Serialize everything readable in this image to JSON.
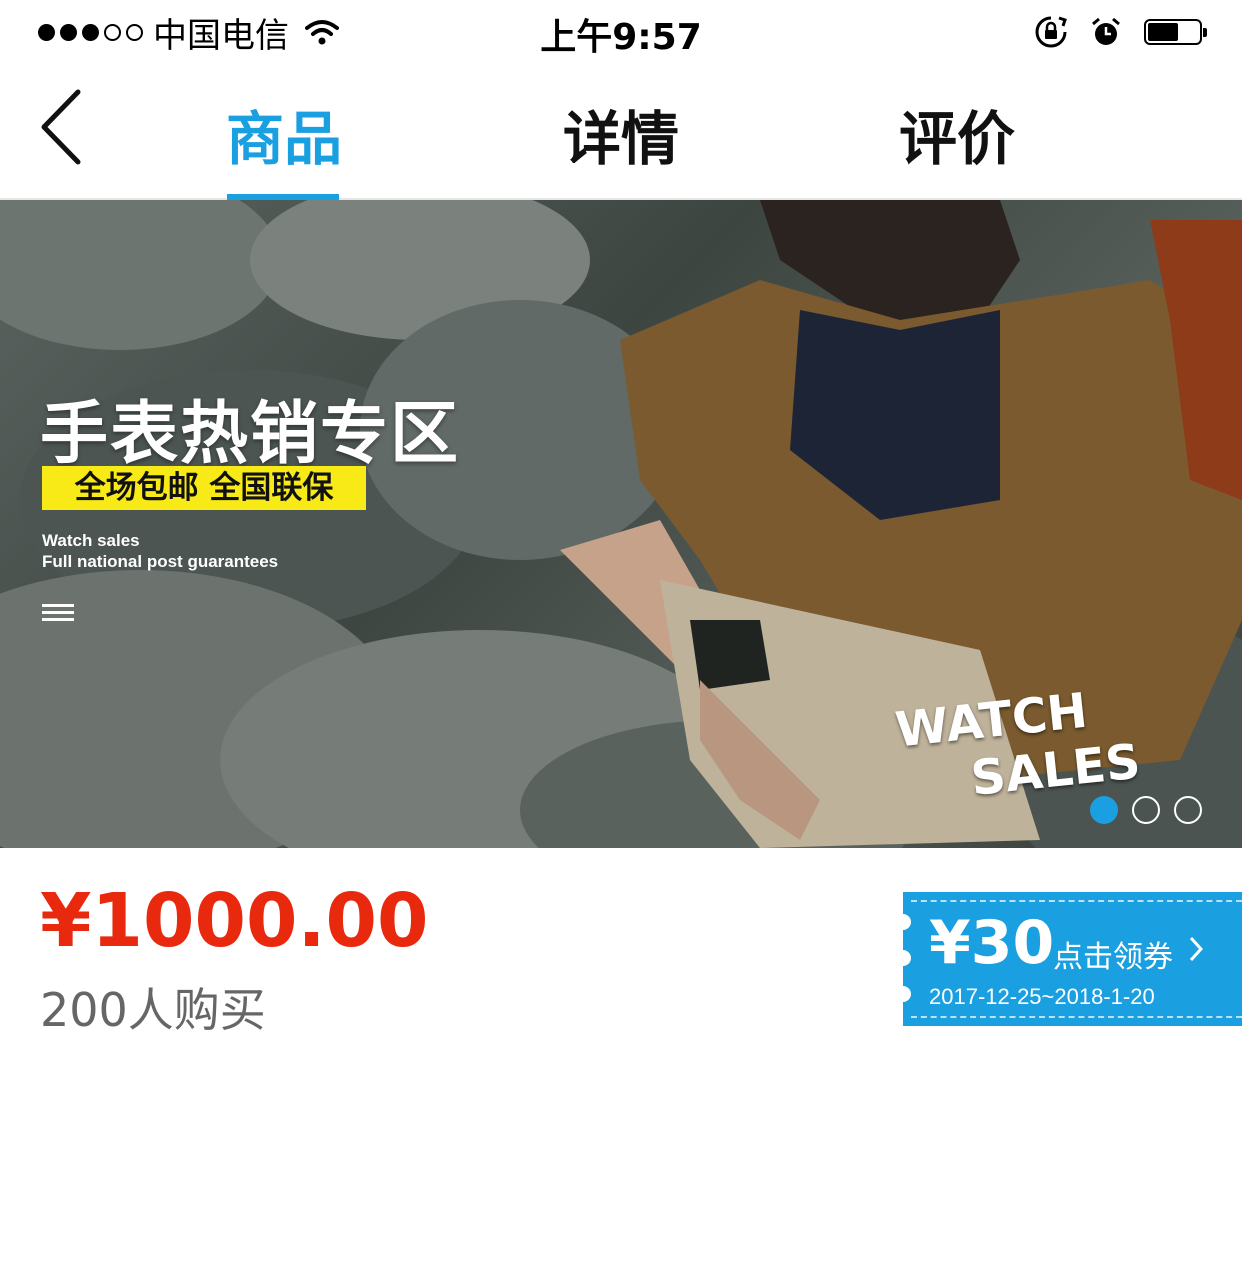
{
  "status_bar": {
    "carrier": "中国电信",
    "time": "上午9:57",
    "signal_bars_filled": 3,
    "signal_bars_total": 5,
    "battery_level": 0.6
  },
  "nav": {
    "tabs": [
      {
        "label": "商品",
        "active": true
      },
      {
        "label": "详情",
        "active": false
      },
      {
        "label": "评价",
        "active": false
      }
    ]
  },
  "banner": {
    "title": "手表热销专区",
    "tag": "全场包邮 全国联保",
    "subtitle_line1": "Watch sales",
    "subtitle_line2": "Full national post guarantees",
    "watch_text_1": "WATCH",
    "watch_text_2": "SALES",
    "slides_total": 3,
    "active_slide": 1
  },
  "product": {
    "price": "¥1000.00",
    "buyers": "200人购买"
  },
  "coupon": {
    "amount": "¥30",
    "action": "点击领券",
    "dates": "2017-12-25~2018-1-20"
  },
  "colors": {
    "accent": "#1a9fe0",
    "price": "#e8290e",
    "tag_yellow": "#f8ea16"
  }
}
